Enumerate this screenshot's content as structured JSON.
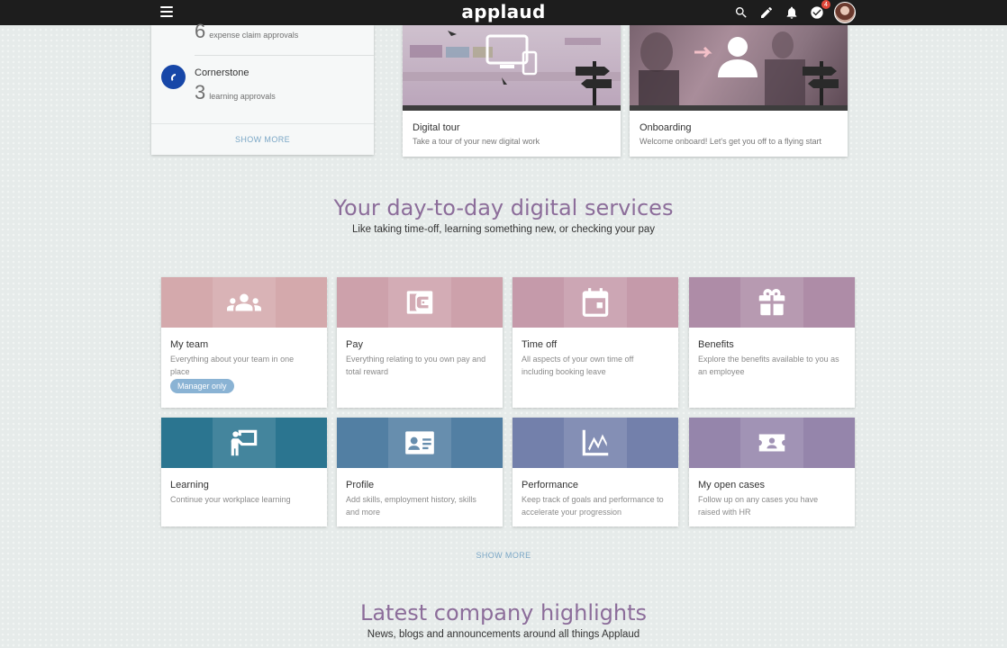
{
  "header": {
    "app_title": "applaud",
    "notification_badge": "4"
  },
  "approvals": {
    "items": [
      {
        "count": "6",
        "label": "expense claim approvals"
      },
      {
        "name": "Cornerstone",
        "count": "3",
        "label": "learning approvals"
      }
    ],
    "show_more": "SHOW MORE"
  },
  "tours": [
    {
      "title": "Digital tour",
      "subtitle": "Take a tour of your new digital work"
    },
    {
      "title": "Onboarding",
      "subtitle": "Welcome onboard! Let's get you off to a flying start"
    }
  ],
  "services": {
    "heading": "Your day-to-day digital services",
    "subheading": "Like taking time-off, learning something new, or checking your pay",
    "tiles": [
      {
        "title": "My team",
        "desc": "Everything about your team in one place",
        "tag": "Manager only",
        "icon": "team-icon",
        "color": "#d4a9ac"
      },
      {
        "title": "Pay",
        "desc": "Everything relating to you own pay and total reward",
        "icon": "wallet-icon",
        "color": "#cda1ab"
      },
      {
        "title": "Time off",
        "desc": "All aspects of your own time off including booking leave",
        "icon": "calendar-icon",
        "color": "#c59aaa"
      },
      {
        "title": "Benefits",
        "desc": "Explore the benefits available to you as an employee",
        "icon": "gift-icon",
        "color": "#ae8ca7"
      },
      {
        "title": "Learning",
        "desc": "Continue your workplace learning",
        "icon": "presenter-icon",
        "color": "#2b7590"
      },
      {
        "title": "Profile",
        "desc": "Add skills, employment history, skills and more",
        "icon": "id-card-icon",
        "color": "#527fa3"
      },
      {
        "title": "Performance",
        "desc": "Keep track of goals and performance to accelerate your progression",
        "icon": "chart-line-icon",
        "color": "#7380ab"
      },
      {
        "title": "My open cases",
        "desc": "Follow up on any cases you have raised with HR",
        "icon": "ticket-icon",
        "color": "#9585ab"
      }
    ],
    "show_more": "SHOW MORE"
  },
  "highlights": {
    "heading": "Latest company highlights",
    "subheading": "News, blogs and announcements around all things Applaud"
  }
}
